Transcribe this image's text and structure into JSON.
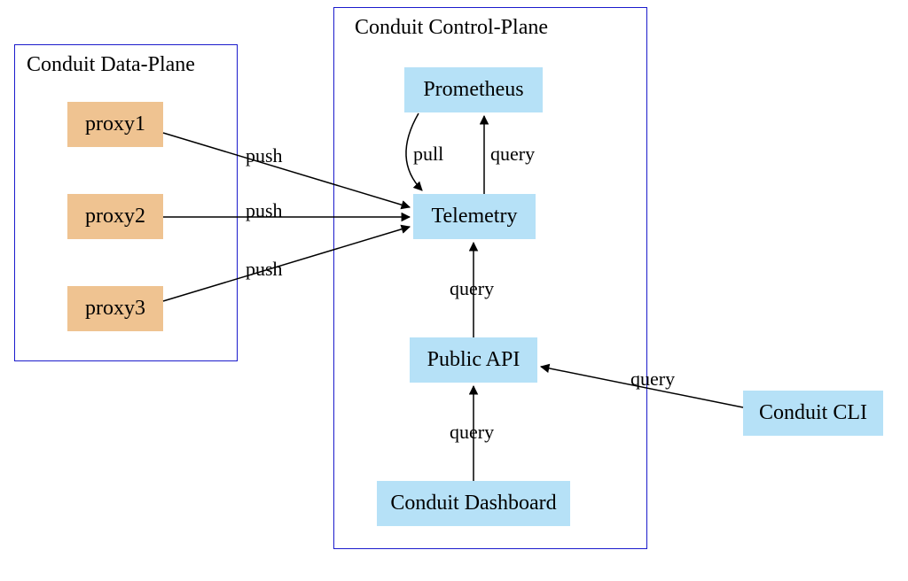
{
  "clusters": {
    "data_plane": {
      "label": "Conduit Data-Plane"
    },
    "control_plane": {
      "label": "Conduit Control-Plane"
    }
  },
  "nodes": {
    "proxy1": "proxy1",
    "proxy2": "proxy2",
    "proxy3": "proxy3",
    "prometheus": "Prometheus",
    "telemetry": "Telemetry",
    "public_api": "Public API",
    "dashboard": "Conduit Dashboard",
    "cli": "Conduit CLI"
  },
  "edges": {
    "push1": "push",
    "push2": "push",
    "push3": "push",
    "pull": "pull",
    "query_tel_prom": "query",
    "query_api_tel": "query",
    "query_dash_api": "query",
    "query_cli_api": "query"
  }
}
